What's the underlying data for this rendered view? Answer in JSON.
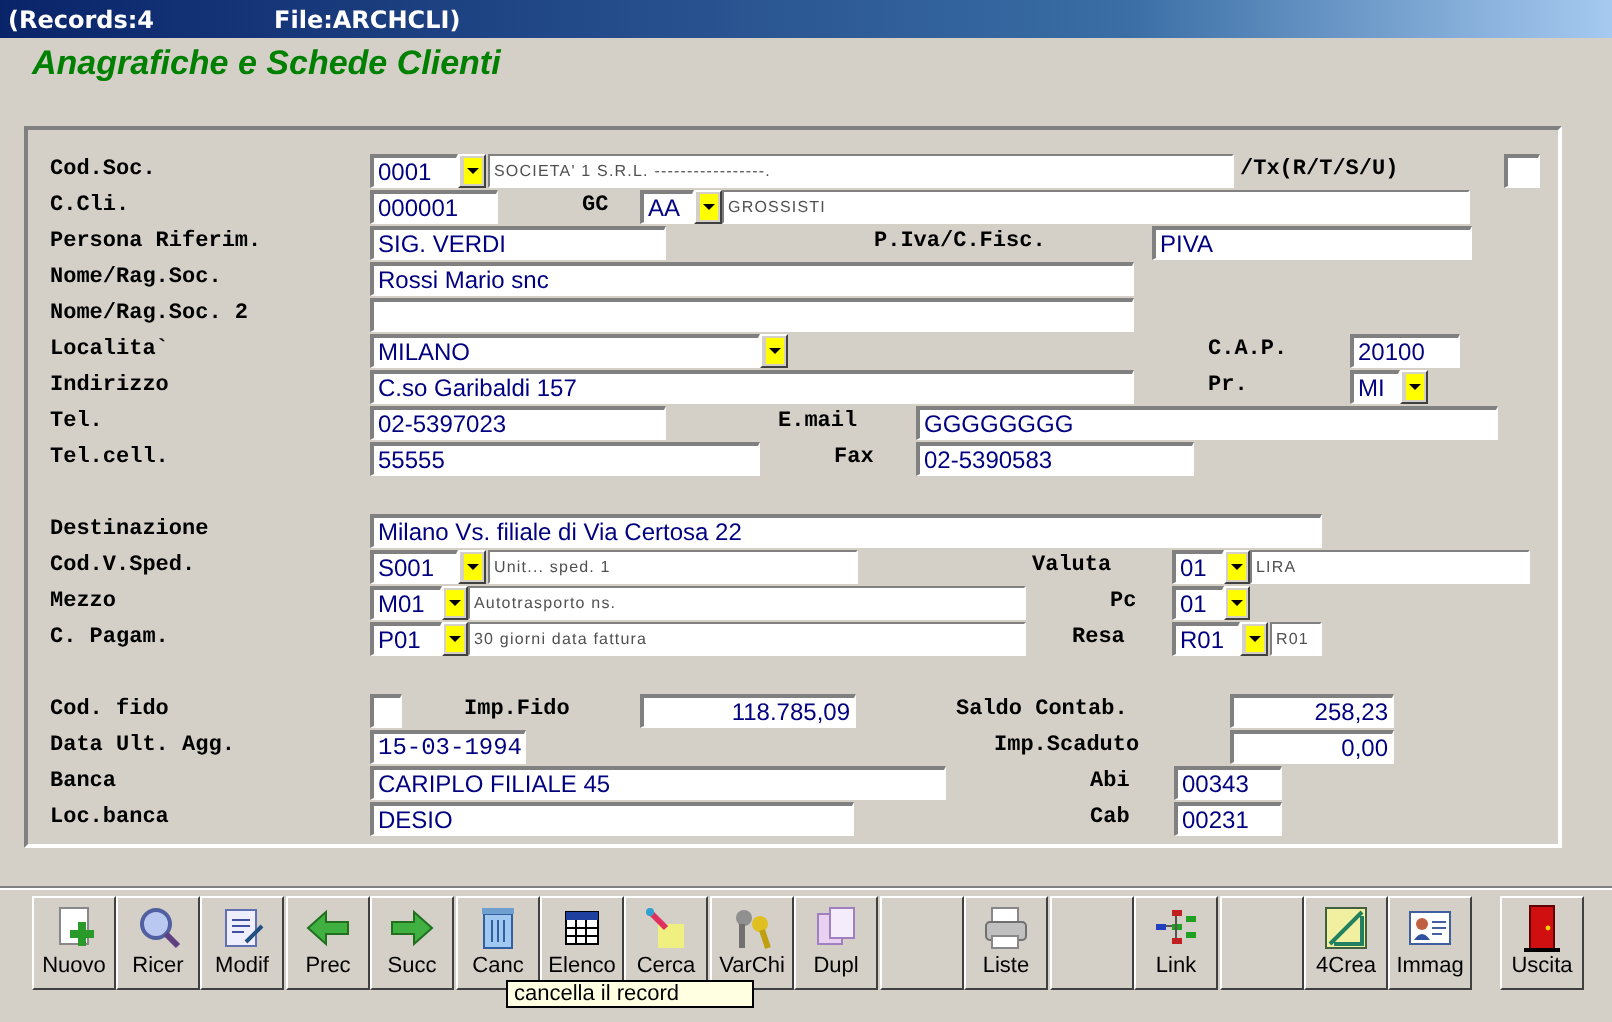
{
  "window": {
    "title": "(Records:4",
    "file": "File:ARCHCLI)"
  },
  "heading": "Anagrafiche e Schede Clienti",
  "form": {
    "rows": [
      {
        "items": [
          {
            "kind": "label",
            "text": "Cod.Soc."
          },
          {
            "kind": "field",
            "value": "0001"
          },
          {
            "kind": "dropdown"
          },
          {
            "kind": "description",
            "value": "SOCIETA' 1 S.R.L. -----------------."
          },
          {
            "kind": "label",
            "text": "/Tx(R/T/S/U)"
          },
          {
            "kind": "field"
          }
        ]
      },
      {
        "items": [
          {
            "kind": "label",
            "text": "C.Cli."
          },
          {
            "kind": "field",
            "value": "000001"
          },
          {
            "kind": "label",
            "text": "GC"
          },
          {
            "kind": "field",
            "value": "AA"
          },
          {
            "kind": "dropdown"
          },
          {
            "kind": "description",
            "value": "GROSSISTI"
          }
        ]
      },
      {
        "items": [
          {
            "kind": "label",
            "text": "Persona Riferim."
          },
          {
            "kind": "field",
            "value": "SIG. VERDI"
          },
          {
            "kind": "label",
            "text": "P.Iva/C.Fisc."
          },
          {
            "kind": "field",
            "value": "PIVA"
          }
        ]
      },
      {
        "items": [
          {
            "kind": "label",
            "text": "Nome/Rag.Soc."
          },
          {
            "kind": "field",
            "value": "Rossi Mario snc"
          }
        ]
      },
      {
        "items": [
          {
            "kind": "label",
            "text": "Nome/Rag.Soc. 2"
          },
          {
            "kind": "field"
          }
        ]
      },
      {
        "items": [
          {
            "kind": "label",
            "text": "Localita`"
          },
          {
            "kind": "field",
            "value": "MILANO"
          },
          {
            "kind": "dropdown"
          },
          {
            "kind": "label",
            "text": "C.A.P."
          },
          {
            "kind": "field",
            "value": "20100"
          }
        ]
      },
      {
        "items": [
          {
            "kind": "label",
            "text": "Indirizzo"
          },
          {
            "kind": "field",
            "value": "C.so Garibaldi 157"
          },
          {
            "kind": "label",
            "text": "Pr."
          },
          {
            "kind": "field",
            "value": "MI"
          },
          {
            "kind": "dropdown"
          }
        ]
      },
      {
        "items": [
          {
            "kind": "label",
            "text": "Tel."
          },
          {
            "kind": "field",
            "value": "02-5397023"
          },
          {
            "kind": "label",
            "text": "E.mail"
          },
          {
            "kind": "field",
            "value": "GGGGGGGG"
          }
        ]
      },
      {
        "items": [
          {
            "kind": "label",
            "text": "Tel.cell."
          },
          {
            "kind": "field",
            "value": "55555"
          },
          {
            "kind": "label",
            "text": "Fax"
          },
          {
            "kind": "field",
            "value": "02-5390583"
          }
        ]
      },
      {
        "items": [
          {
            "kind": "label",
            "text": "Destinazione"
          },
          {
            "kind": "field",
            "value": "Milano Vs. filiale di Via Certosa 22"
          }
        ]
      },
      {
        "items": [
          {
            "kind": "label",
            "text": "Cod.V.Sped."
          },
          {
            "kind": "field",
            "value": "S001"
          },
          {
            "kind": "dropdown"
          },
          {
            "kind": "description",
            "value": "Unit... sped. 1"
          },
          {
            "kind": "label",
            "text": "Valuta"
          },
          {
            "kind": "field",
            "value": "01"
          },
          {
            "kind": "dropdown"
          },
          {
            "kind": "description",
            "value": "LIRA"
          }
        ]
      },
      {
        "items": [
          {
            "kind": "label",
            "text": "Mezzo"
          },
          {
            "kind": "field",
            "value": "M01"
          },
          {
            "kind": "dropdown"
          },
          {
            "kind": "description",
            "value": "Autotrasporto ns."
          },
          {
            "kind": "label",
            "text": "Pc"
          },
          {
            "kind": "field",
            "value": "01"
          },
          {
            "kind": "dropdown"
          }
        ]
      },
      {
        "items": [
          {
            "kind": "label",
            "text": "C. Pagam."
          },
          {
            "kind": "field",
            "value": "P01"
          },
          {
            "kind": "dropdown"
          },
          {
            "kind": "description",
            "value": "30 giorni data fattura"
          },
          {
            "kind": "label",
            "text": "Resa"
          },
          {
            "kind": "field",
            "value": "R01"
          },
          {
            "kind": "dropdown"
          },
          {
            "kind": "description",
            "value": "R01"
          }
        ]
      },
      {
        "items": [
          {
            "kind": "label",
            "text": "Cod. fido"
          },
          {
            "kind": "field"
          },
          {
            "kind": "label",
            "text": "Imp.Fido"
          },
          {
            "kind": "amount",
            "value": "118.785,09"
          },
          {
            "kind": "label",
            "text": "Saldo Contab."
          },
          {
            "kind": "amount",
            "value": "258,23"
          }
        ]
      },
      {
        "items": [
          {
            "kind": "label",
            "text": "Data Ult. Agg."
          },
          {
            "kind": "date",
            "value": "15-03-1994"
          },
          {
            "kind": "label",
            "text": "Imp.Scaduto"
          },
          {
            "kind": "amount",
            "value": "0,00"
          }
        ]
      },
      {
        "items": [
          {
            "kind": "label",
            "text": "Banca"
          },
          {
            "kind": "field",
            "value": "CARIPLO FILIALE 45"
          },
          {
            "kind": "label",
            "text": "Abi"
          },
          {
            "kind": "field",
            "value": "00343"
          }
        ]
      },
      {
        "items": [
          {
            "kind": "label",
            "text": "Loc.banca"
          },
          {
            "kind": "field",
            "value": "DESIO"
          },
          {
            "kind": "label",
            "text": "Cab"
          },
          {
            "kind": "field",
            "value": "00231"
          }
        ]
      }
    ]
  },
  "toolbar": [
    {
      "kind": "button",
      "label": "Nuovo"
    },
    {
      "kind": "button",
      "label": "Ricer"
    },
    {
      "kind": "button",
      "label": "Modif"
    },
    {
      "kind": "button",
      "label": "Prec"
    },
    {
      "kind": "button",
      "label": "Succ"
    },
    {
      "kind": "button",
      "label": "Canc"
    },
    {
      "kind": "button",
      "label": "Elenco"
    },
    {
      "kind": "button",
      "label": "Cerca"
    },
    {
      "kind": "button",
      "label": "VarChi"
    },
    {
      "kind": "button",
      "label": "Dupl"
    },
    {
      "kind": "blank"
    },
    {
      "kind": "button",
      "label": "Liste"
    },
    {
      "kind": "blank"
    },
    {
      "kind": "button",
      "label": "Link"
    },
    {
      "kind": "blank"
    },
    {
      "kind": "button",
      "label": "4Crea"
    },
    {
      "kind": "button",
      "label": "Immag"
    },
    {
      "kind": "button",
      "label": "Uscita"
    }
  ],
  "tooltip": "cancella il record"
}
